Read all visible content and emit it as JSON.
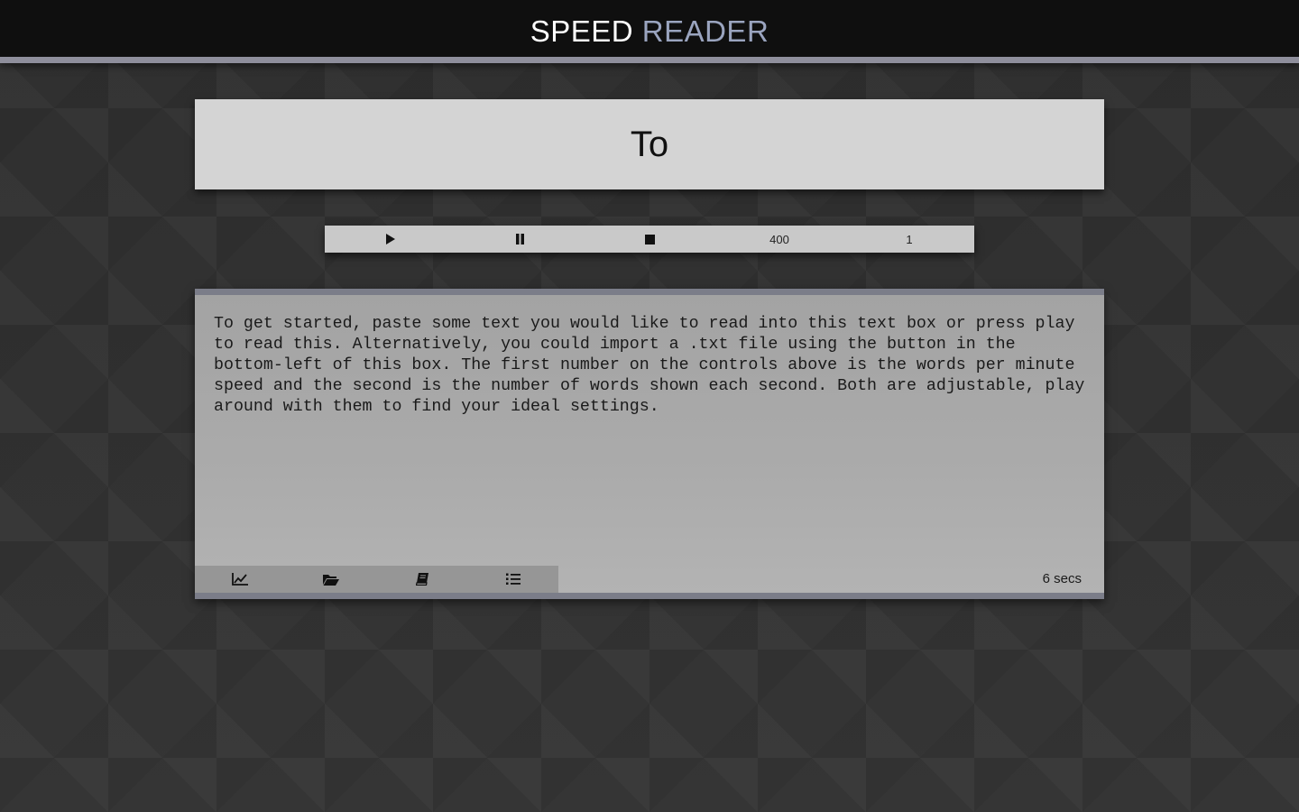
{
  "header": {
    "title_part1": "SPEED",
    "title_part2": "READER"
  },
  "display": {
    "current_word": "To"
  },
  "controls": {
    "play_icon": "play-icon",
    "pause_icon": "pause-icon",
    "stop_icon": "stop-icon",
    "wpm": "400",
    "words_per_flash": "1"
  },
  "text_panel": {
    "content": "To get started, paste some text you would like to read into this text box or press play to read this. Alternatively, you could import a .txt file using the button in the bottom-left of this box. The first number on the controls above is the words per minute speed and the second is the number of words shown each second. Both are adjustable, play around with them to find your ideal settings.",
    "toolbar_icons": [
      "chart-line-icon",
      "folder-open-icon",
      "book-icon",
      "list-ol-icon"
    ],
    "time_estimate": "6 secs"
  },
  "colors": {
    "header_bg": "#0f0f0f",
    "title_accent": "#9aa4bf",
    "border_accent": "#8f8f9c"
  }
}
